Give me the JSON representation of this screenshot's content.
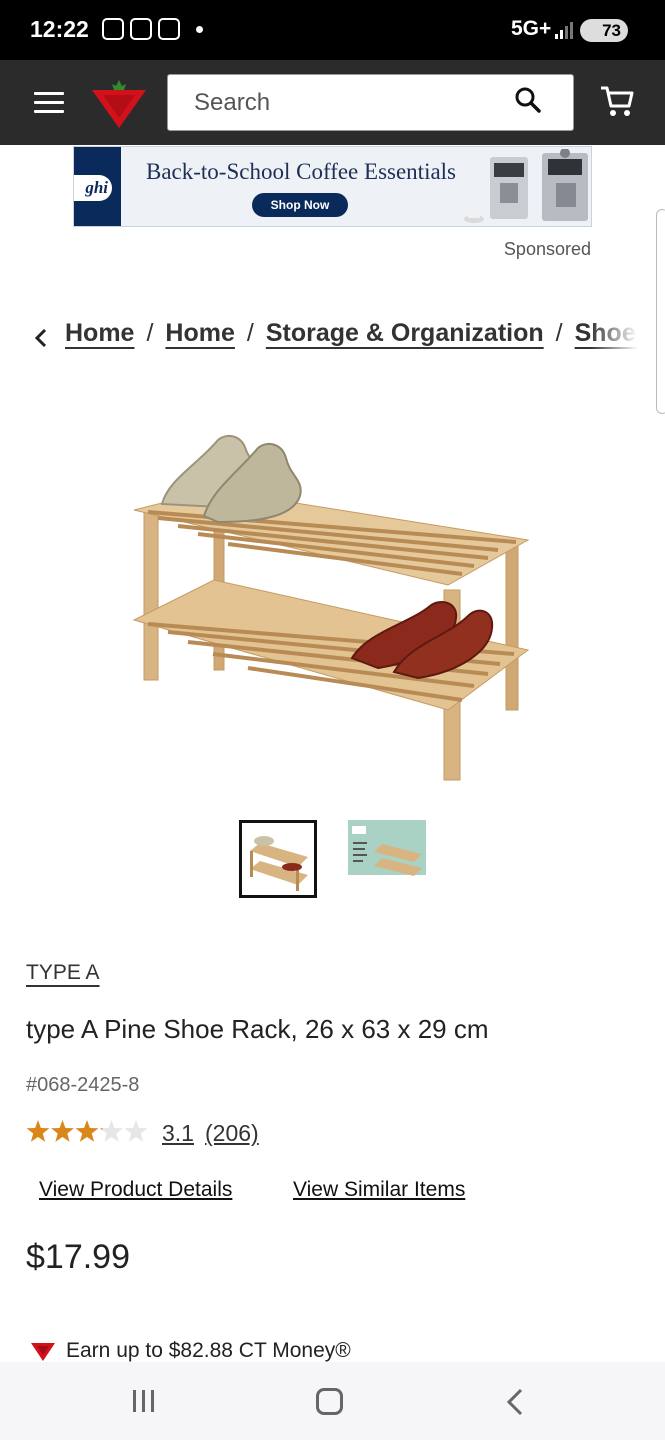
{
  "status_bar": {
    "time": "12:22",
    "network": "5G+",
    "battery": "73"
  },
  "header": {
    "search_placeholder": "Search",
    "logo": "canadian-tire-triangle-logo"
  },
  "ad": {
    "brand_fragment": "ghi",
    "headline": "Back-to-School Coffee Essentials",
    "button_label": "Shop Now",
    "sponsored_label": "Sponsored"
  },
  "breadcrumb": {
    "items": [
      "Home",
      "Home",
      "Storage & Organization",
      "Shoe Racks"
    ],
    "separator": "/"
  },
  "product": {
    "brand": "TYPE A",
    "title": "type A Pine Shoe Rack, 26 x 63 x 29 cm",
    "sku": "#068-2425-8",
    "rating_value": "3.1",
    "rating_count": "(206)",
    "rating_stars": 3.1,
    "rating_max": 5,
    "view_details_label": "View Product Details",
    "view_similar_label": "View Similar Items",
    "price": "$17.99",
    "ct_money": "Earn up to $82.88 CT Money®"
  },
  "gallery": {
    "thumbnails": [
      "shoe-rack-product-photo",
      "shoe-rack-packaging-photo"
    ],
    "selected_index": 0
  },
  "colors": {
    "header_bg": "#2b2b2b",
    "brand_red": "#d3111c",
    "star_gold": "#d9861a"
  }
}
